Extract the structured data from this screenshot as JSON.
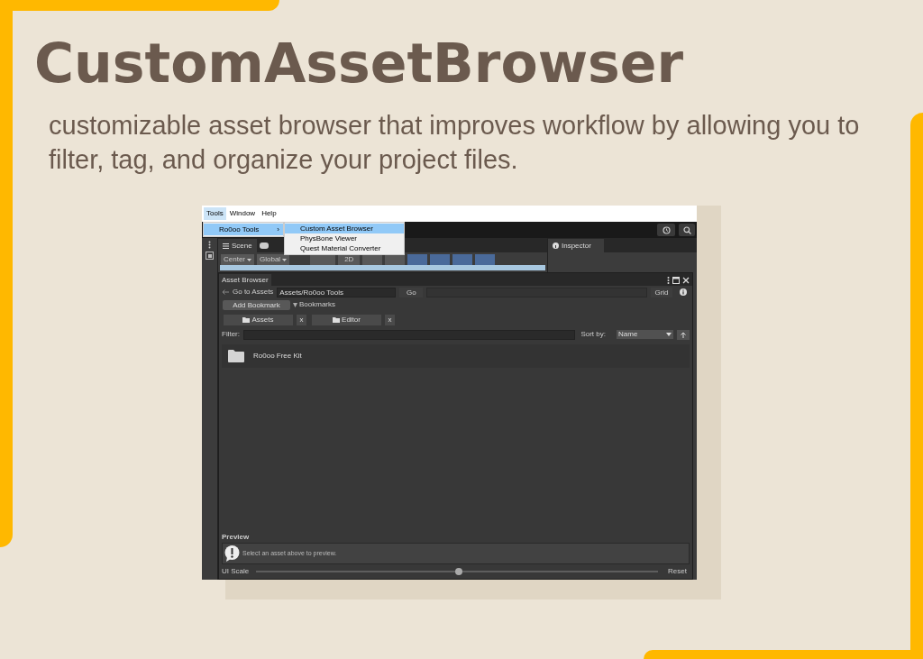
{
  "heading": {
    "title": "CustomAssetBrowser",
    "subtitle": "customizable asset browser that improves workflow by allowing you to filter, tag, and organize your project files."
  },
  "editor": {
    "menu_bar": [
      {
        "label": "Tools",
        "selected": true
      },
      {
        "label": "Window",
        "selected": false
      },
      {
        "label": "Help",
        "selected": false
      }
    ],
    "tools_menu": [
      {
        "label": "Ro0oo Tools",
        "arrow": "›",
        "selected": true
      }
    ],
    "submenu": [
      {
        "label": "Custom Asset Browser",
        "selected": true
      },
      {
        "label": "PhysBone Viewer",
        "selected": false
      },
      {
        "label": "Quest Material Converter",
        "selected": false
      }
    ],
    "scene_tab": {
      "label": "Scene"
    },
    "scene_toolbar": {
      "pivot": "Center",
      "space": "Global",
      "mode": "2D"
    },
    "inspector_tab": {
      "label": "Inspector"
    },
    "asset_browser": {
      "title": "Asset Browser",
      "go_to_assets": "Go to Assets",
      "path": "Assets/Ro0oo Tools",
      "go": "Go",
      "view": "Grid",
      "add_bookmark": "Add Bookmark",
      "bookmarks_label": "Bookmarks",
      "bookmarks_expanded": true,
      "bookmarks": [
        {
          "label": "Assets",
          "remove": "x"
        },
        {
          "label": "Editor",
          "remove": "x"
        }
      ],
      "filter_label": "Filter:",
      "sort_label": "Sort by:",
      "sort_value": "Name",
      "items": [
        {
          "name": "Ro0oo Free Kit",
          "kind": "folder"
        }
      ],
      "preview_label": "Preview",
      "preview_message": "Select an asset above to preview.",
      "scale_label": "UI Scale",
      "scale": {
        "level": 0.503
      },
      "reset": "Reset"
    }
  }
}
